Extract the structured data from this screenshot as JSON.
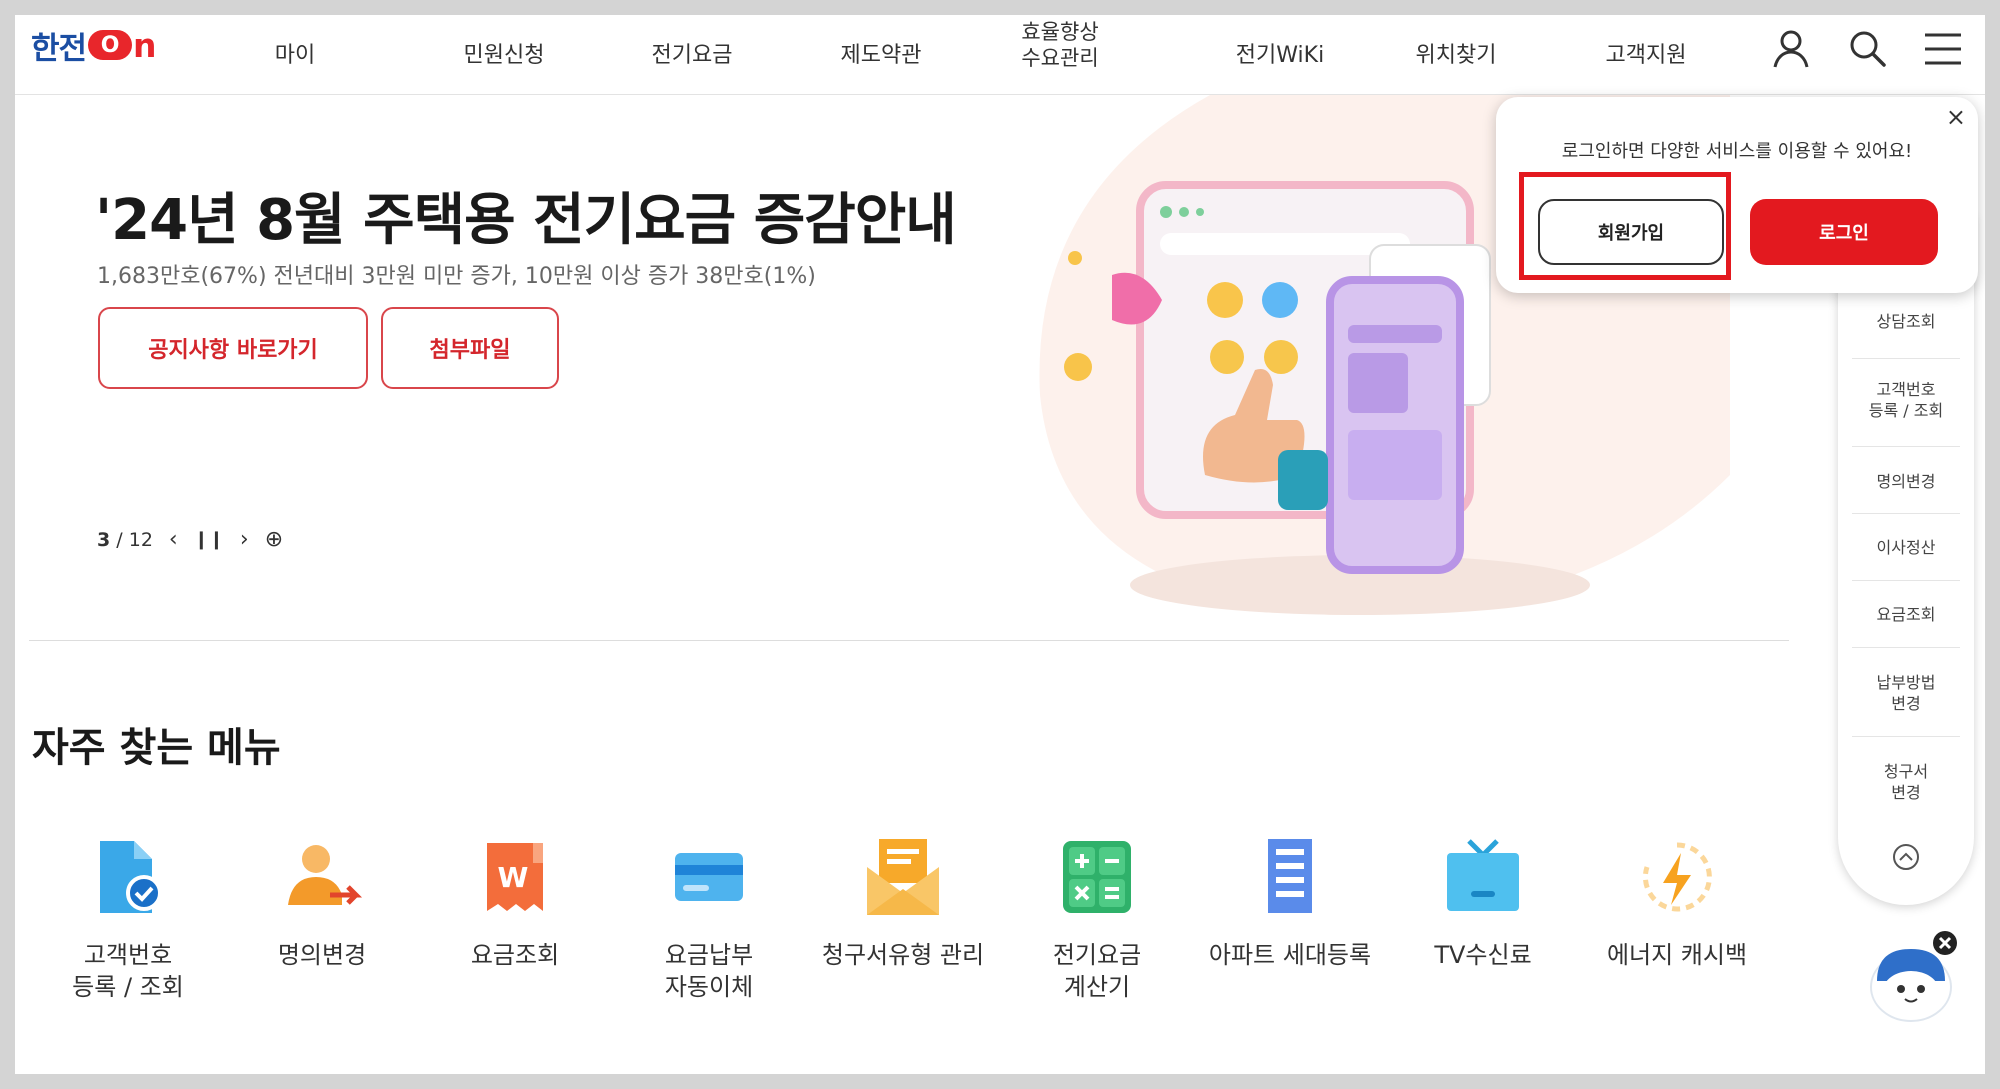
{
  "header": {
    "logo_text": "한전",
    "logo_on": "O",
    "logo_n": "n",
    "nav": [
      {
        "label": "마이"
      },
      {
        "label": "민원신청"
      },
      {
        "label": "전기요금"
      },
      {
        "label": "제도약관"
      },
      {
        "label": "효율향상\n수요관리"
      },
      {
        "label": "전기WiKi"
      },
      {
        "label": "위치찾기"
      },
      {
        "label": "고객지원"
      }
    ],
    "icons": [
      "user-icon",
      "search-icon",
      "menu-icon"
    ]
  },
  "hero": {
    "title": "'24년 8월 주택용 전기요금 증감안내",
    "subtitle": "1,683만호(67%) 전년대비 3만원 미만 증가, 10만원 이상 증가 38만호(1%)",
    "buttons": [
      {
        "label": "공지사항 바로가기"
      },
      {
        "label": "첨부파일"
      }
    ],
    "slider": {
      "current": "3",
      "separator": "/",
      "total": "12"
    }
  },
  "frequent_menu": {
    "title": "자주 찾는 메뉴",
    "items": [
      {
        "label": "고객번호\n등록 / 조회",
        "icon": "document-check-icon"
      },
      {
        "label": "명의변경",
        "icon": "person-change-icon"
      },
      {
        "label": "요금조회",
        "icon": "bill-won-icon"
      },
      {
        "label": "요금납부\n자동이체",
        "icon": "card-icon"
      },
      {
        "label": "청구서유형 관리",
        "icon": "envelope-icon"
      },
      {
        "label": "전기요금\n계산기",
        "icon": "calculator-icon"
      },
      {
        "label": "아파트 세대등록",
        "icon": "apartment-icon"
      },
      {
        "label": "TV수신료",
        "icon": "tv-icon"
      },
      {
        "label": "에너지 캐시백",
        "icon": "energy-bolt-icon"
      }
    ]
  },
  "quick_panel": {
    "items": [
      {
        "label": "상담조회"
      },
      {
        "label": "고객번호\n등록 / 조회"
      },
      {
        "label": "명의변경"
      },
      {
        "label": "이사정산"
      },
      {
        "label": "요금조회"
      },
      {
        "label": "납부방법\n변경"
      },
      {
        "label": "청구서\n변경"
      }
    ],
    "top_icon": "chevron-up-circle-icon"
  },
  "login_popup": {
    "message": "로그인하면 다양한 서비스를 이용할 수 있어요!",
    "close": "×",
    "signup_label": "회원가입",
    "login_label": "로그인"
  },
  "colors": {
    "brand_red": "#e3191f",
    "brand_blue": "#1b4ea3",
    "highlight": "#e3191f"
  }
}
